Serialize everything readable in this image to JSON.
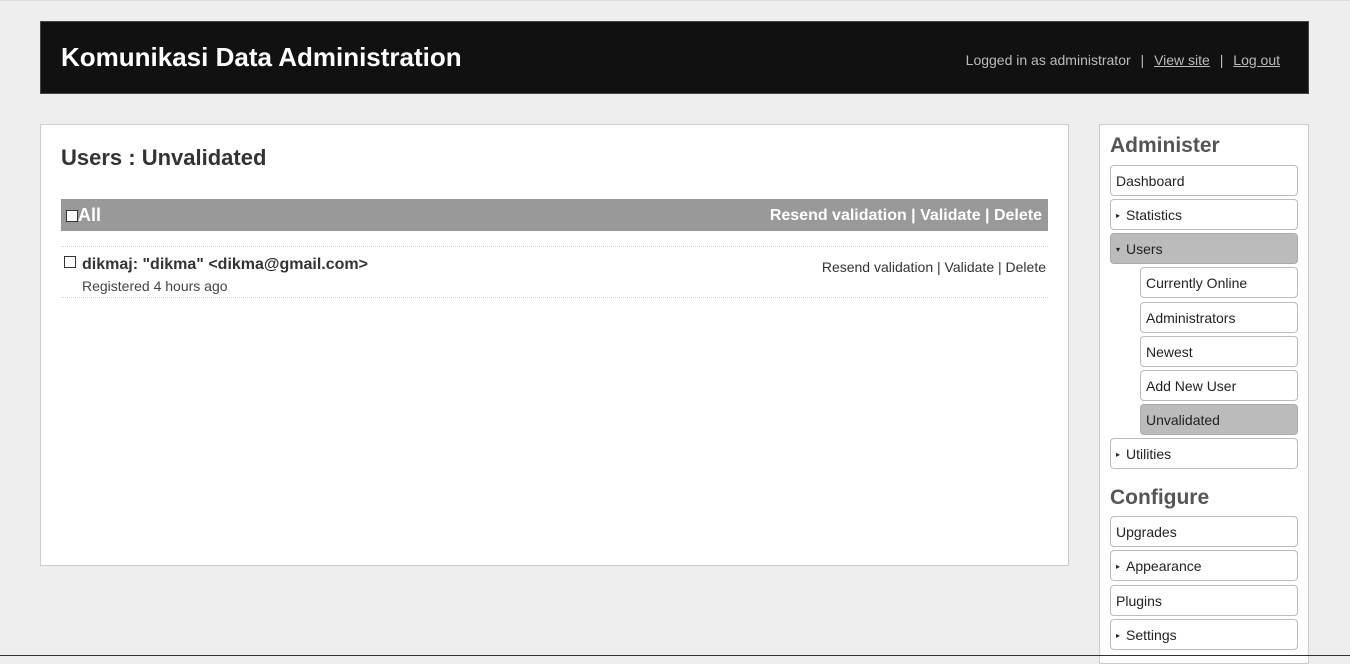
{
  "header": {
    "title": "Komunikasi Data Administration",
    "logged_in": "Logged in as administrator",
    "view_site": "View site",
    "log_out": "Log out",
    "separator": "|"
  },
  "main": {
    "heading": "Users : Unvalidated",
    "bulk": {
      "all_label": "All",
      "resend": "Resend validation",
      "validate": "Validate",
      "delete": "Delete",
      "separator": " | "
    },
    "users": [
      {
        "identity": "dikmaj: \"dikma\" <dikma@gmail.com>",
        "registered": "Registered 4 hours ago",
        "resend": "Resend validation",
        "validate": "Validate",
        "delete": "Delete",
        "separator": " | "
      }
    ]
  },
  "sidebar": {
    "administer_heading": "Administer",
    "configure_heading": "Configure",
    "administer": [
      {
        "label": "Dashboard"
      },
      {
        "label": "Statistics",
        "marker": "▸"
      },
      {
        "label": "Users",
        "marker": "▾"
      },
      {
        "label": "Currently Online"
      },
      {
        "label": "Administrators"
      },
      {
        "label": "Newest"
      },
      {
        "label": "Add New User"
      },
      {
        "label": "Unvalidated"
      },
      {
        "label": "Utilities",
        "marker": "▸"
      }
    ],
    "configure": [
      {
        "label": "Upgrades"
      },
      {
        "label": "Appearance",
        "marker": "▸"
      },
      {
        "label": "Plugins"
      },
      {
        "label": "Settings",
        "marker": "▸"
      }
    ]
  }
}
